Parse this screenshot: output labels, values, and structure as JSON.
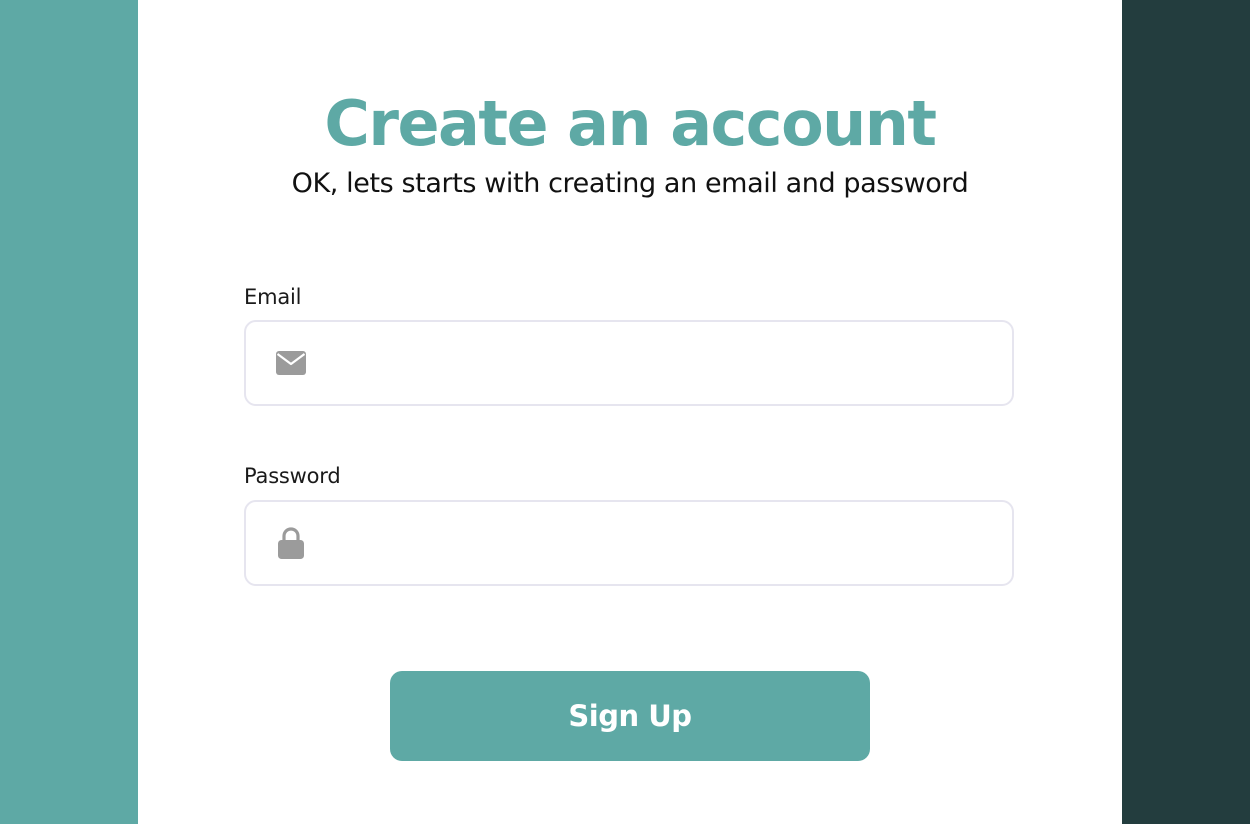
{
  "header": {
    "title": "Create an account",
    "subtitle": "OK, lets starts with creating an email and password"
  },
  "form": {
    "email": {
      "label": "Email",
      "value": "",
      "placeholder": "",
      "icon": "envelope-icon"
    },
    "password": {
      "label": "Password",
      "value": "",
      "placeholder": "",
      "icon": "lock-icon"
    },
    "submit_label": "Sign Up"
  },
  "colors": {
    "accent": "#5ea9a5",
    "sidebar_left": "#5ea9a5",
    "sidebar_right": "#233d3e",
    "icon_gray": "#9b9b9b",
    "input_border": "#e6e5ef"
  }
}
